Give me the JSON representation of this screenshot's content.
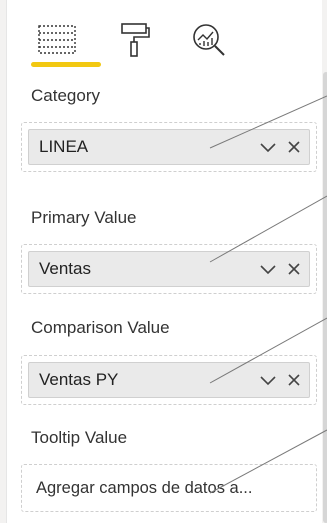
{
  "tabs": [
    {
      "name": "fields",
      "icon": "fields-grid-icon",
      "active": true
    },
    {
      "name": "format",
      "icon": "paint-roller-icon",
      "active": false
    },
    {
      "name": "analytics",
      "icon": "analytics-magnifier-icon",
      "active": false
    }
  ],
  "accent_color": "#f2c811",
  "wells": {
    "category": {
      "label": "Category",
      "value": "LINEA"
    },
    "primary": {
      "label": "Primary Value",
      "value": "Ventas"
    },
    "comparison": {
      "label": "Comparison Value",
      "value": "Ventas PY"
    },
    "tooltip": {
      "label": "Tooltip Value",
      "placeholder": "Agregar campos de datos a..."
    }
  },
  "pill_actions": {
    "expand_icon": "chevron-down-icon",
    "remove_icon": "close-icon"
  }
}
